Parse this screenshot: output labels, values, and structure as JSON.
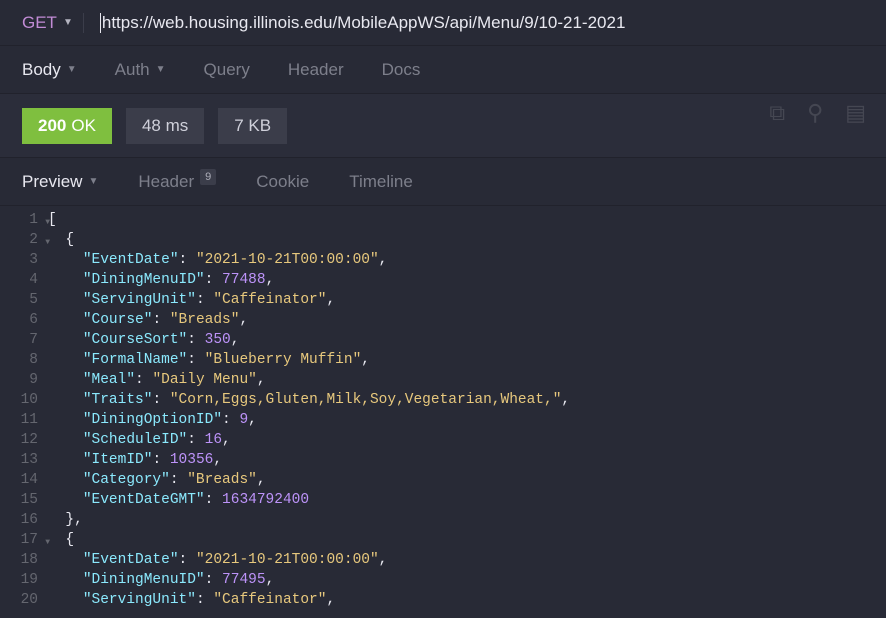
{
  "request": {
    "method": "GET",
    "url": "https://web.housing.illinois.edu/MobileAppWS/api/Menu/9/10-21-2021"
  },
  "request_tabs": {
    "body": "Body",
    "auth": "Auth",
    "query": "Query",
    "header": "Header",
    "docs": "Docs",
    "active": "body"
  },
  "status": {
    "code": "200",
    "text": "OK",
    "time": "48 ms",
    "size": "7 KB"
  },
  "response_tabs": {
    "preview": "Preview",
    "header": "Header",
    "header_badge": "9",
    "cookie": "Cookie",
    "timeline": "Timeline",
    "active": "preview"
  },
  "code_lines": [
    {
      "n": 1,
      "fold": true,
      "indent": 0,
      "tokens": [
        {
          "t": "p",
          "v": "["
        }
      ]
    },
    {
      "n": 2,
      "fold": true,
      "indent": 1,
      "tokens": [
        {
          "t": "p",
          "v": "{"
        }
      ]
    },
    {
      "n": 3,
      "fold": false,
      "indent": 2,
      "tokens": [
        {
          "t": "k",
          "v": "\"EventDate\""
        },
        {
          "t": "p",
          "v": ": "
        },
        {
          "t": "s",
          "v": "\"2021-10-21T00:00:00\""
        },
        {
          "t": "p",
          "v": ","
        }
      ]
    },
    {
      "n": 4,
      "fold": false,
      "indent": 2,
      "tokens": [
        {
          "t": "k",
          "v": "\"DiningMenuID\""
        },
        {
          "t": "p",
          "v": ": "
        },
        {
          "t": "n",
          "v": "77488"
        },
        {
          "t": "p",
          "v": ","
        }
      ]
    },
    {
      "n": 5,
      "fold": false,
      "indent": 2,
      "tokens": [
        {
          "t": "k",
          "v": "\"ServingUnit\""
        },
        {
          "t": "p",
          "v": ": "
        },
        {
          "t": "s",
          "v": "\"Caffeinator\""
        },
        {
          "t": "p",
          "v": ","
        }
      ]
    },
    {
      "n": 6,
      "fold": false,
      "indent": 2,
      "tokens": [
        {
          "t": "k",
          "v": "\"Course\""
        },
        {
          "t": "p",
          "v": ": "
        },
        {
          "t": "s",
          "v": "\"Breads\""
        },
        {
          "t": "p",
          "v": ","
        }
      ]
    },
    {
      "n": 7,
      "fold": false,
      "indent": 2,
      "tokens": [
        {
          "t": "k",
          "v": "\"CourseSort\""
        },
        {
          "t": "p",
          "v": ": "
        },
        {
          "t": "n",
          "v": "350"
        },
        {
          "t": "p",
          "v": ","
        }
      ]
    },
    {
      "n": 8,
      "fold": false,
      "indent": 2,
      "tokens": [
        {
          "t": "k",
          "v": "\"FormalName\""
        },
        {
          "t": "p",
          "v": ": "
        },
        {
          "t": "s",
          "v": "\"Blueberry Muffin\""
        },
        {
          "t": "p",
          "v": ","
        }
      ]
    },
    {
      "n": 9,
      "fold": false,
      "indent": 2,
      "tokens": [
        {
          "t": "k",
          "v": "\"Meal\""
        },
        {
          "t": "p",
          "v": ": "
        },
        {
          "t": "s",
          "v": "\"Daily Menu\""
        },
        {
          "t": "p",
          "v": ","
        }
      ]
    },
    {
      "n": 10,
      "fold": false,
      "indent": 2,
      "tokens": [
        {
          "t": "k",
          "v": "\"Traits\""
        },
        {
          "t": "p",
          "v": ": "
        },
        {
          "t": "s",
          "v": "\"Corn,Eggs,Gluten,Milk,Soy,Vegetarian,Wheat,\""
        },
        {
          "t": "p",
          "v": ","
        }
      ]
    },
    {
      "n": 11,
      "fold": false,
      "indent": 2,
      "tokens": [
        {
          "t": "k",
          "v": "\"DiningOptionID\""
        },
        {
          "t": "p",
          "v": ": "
        },
        {
          "t": "n",
          "v": "9"
        },
        {
          "t": "p",
          "v": ","
        }
      ]
    },
    {
      "n": 12,
      "fold": false,
      "indent": 2,
      "tokens": [
        {
          "t": "k",
          "v": "\"ScheduleID\""
        },
        {
          "t": "p",
          "v": ": "
        },
        {
          "t": "n",
          "v": "16"
        },
        {
          "t": "p",
          "v": ","
        }
      ]
    },
    {
      "n": 13,
      "fold": false,
      "indent": 2,
      "tokens": [
        {
          "t": "k",
          "v": "\"ItemID\""
        },
        {
          "t": "p",
          "v": ": "
        },
        {
          "t": "n",
          "v": "10356"
        },
        {
          "t": "p",
          "v": ","
        }
      ]
    },
    {
      "n": 14,
      "fold": false,
      "indent": 2,
      "tokens": [
        {
          "t": "k",
          "v": "\"Category\""
        },
        {
          "t": "p",
          "v": ": "
        },
        {
          "t": "s",
          "v": "\"Breads\""
        },
        {
          "t": "p",
          "v": ","
        }
      ]
    },
    {
      "n": 15,
      "fold": false,
      "indent": 2,
      "tokens": [
        {
          "t": "k",
          "v": "\"EventDateGMT\""
        },
        {
          "t": "p",
          "v": ": "
        },
        {
          "t": "n",
          "v": "1634792400"
        }
      ]
    },
    {
      "n": 16,
      "fold": false,
      "indent": 1,
      "tokens": [
        {
          "t": "p",
          "v": "},"
        }
      ]
    },
    {
      "n": 17,
      "fold": true,
      "indent": 1,
      "tokens": [
        {
          "t": "p",
          "v": "{"
        }
      ]
    },
    {
      "n": 18,
      "fold": false,
      "indent": 2,
      "tokens": [
        {
          "t": "k",
          "v": "\"EventDate\""
        },
        {
          "t": "p",
          "v": ": "
        },
        {
          "t": "s",
          "v": "\"2021-10-21T00:00:00\""
        },
        {
          "t": "p",
          "v": ","
        }
      ]
    },
    {
      "n": 19,
      "fold": false,
      "indent": 2,
      "tokens": [
        {
          "t": "k",
          "v": "\"DiningMenuID\""
        },
        {
          "t": "p",
          "v": ": "
        },
        {
          "t": "n",
          "v": "77495"
        },
        {
          "t": "p",
          "v": ","
        }
      ]
    },
    {
      "n": 20,
      "fold": false,
      "indent": 2,
      "tokens": [
        {
          "t": "k",
          "v": "\"ServingUnit\""
        },
        {
          "t": "p",
          "v": ": "
        },
        {
          "t": "s",
          "v": "\"Caffeinator\""
        },
        {
          "t": "p",
          "v": ","
        }
      ]
    }
  ]
}
